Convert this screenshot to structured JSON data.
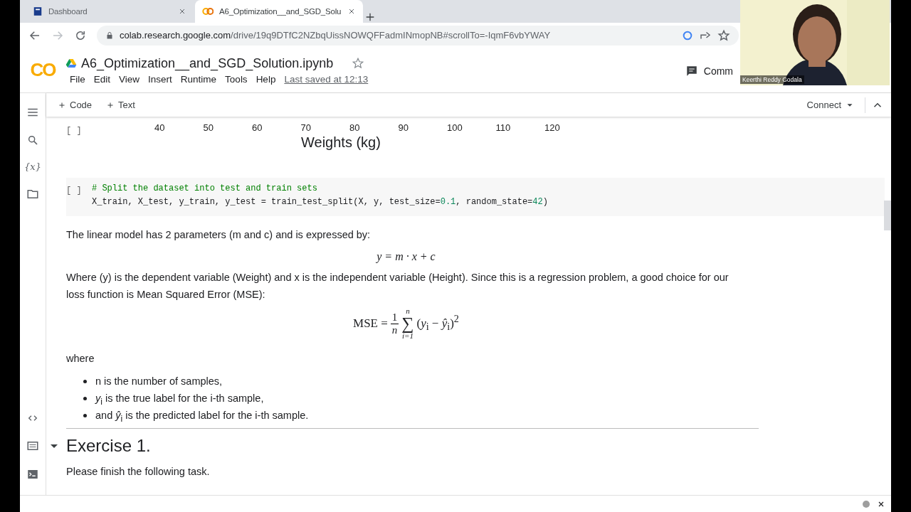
{
  "browser": {
    "tabs": [
      {
        "title": "Dashboard",
        "selected": false,
        "kind": "um"
      },
      {
        "title": "A6_Optimization__and_SGD_Solu",
        "selected": true,
        "kind": "colab"
      }
    ],
    "url_host": "colab.research.google.com",
    "url_path": "/drive/19q9DTfC2NZbqUissNOWQFFadmINmopNB#scrollTo=-IqmF6vbYWAY"
  },
  "notebook": {
    "logo": "CO",
    "title": "A6_Optimization__and_SGD_Solution.ipynb",
    "menu": [
      "File",
      "Edit",
      "View",
      "Insert",
      "Runtime",
      "Tools",
      "Help"
    ],
    "last_saved": "Last saved at 12:13",
    "comment": "Comm",
    "toolbar": [
      "Code",
      "Text"
    ],
    "connect": "Connect",
    "variables_icon": "{x}"
  },
  "cells": [
    {
      "kind": "output",
      "bracket": "[ ]",
      "x_tick_labels": [
        "40",
        "50",
        "60",
        "70",
        "80",
        "90",
        "100",
        "110",
        "120"
      ],
      "xlabel": "Weights (kg)"
    },
    {
      "kind": "code",
      "bracket": "[ ]",
      "lines": [
        [
          {
            "kind": "comment",
            "text": "# Split the dataset into test and train sets"
          }
        ],
        [
          {
            "kind": "plain",
            "text": "X_train, X_test, y_train, y_test = train_test_split(X, y, test_size="
          },
          {
            "kind": "number",
            "text": "0.1"
          },
          {
            "kind": "plain",
            "text": ", random_state="
          },
          {
            "kind": "number",
            "text": "42"
          },
          {
            "kind": "plain",
            "text": ")"
          }
        ]
      ]
    },
    {
      "kind": "text",
      "intro": "The linear model has 2 parameters (m and c) and is expressed by:",
      "formula1": "y = m · x + c",
      "para": "Where (y) is the dependent variable (Weight) and x is the independent variable (Height). Since this is a regression problem, a good choice for our loss function is Mean Squared Error (MSE):",
      "mse": {
        "lhs": "MSE =",
        "numerator": "1",
        "denominator": "n",
        "sum": "∑",
        "upper": "n",
        "lower": "i=1",
        "term": "(*y*$_{i}$ − *ŷ*$_{i}$)$^{2}$"
      },
      "where": "where",
      "bullets": [
        "n is the number of samples,",
        "*y*$_{i}$ is the true label for the i-th sample,",
        "and *ŷ*$_{i}$ is the predicted label for the i-th sample."
      ]
    },
    {
      "kind": "heading",
      "title": "Exercise 1.",
      "expanded": true,
      "text": "Please finish the following task."
    }
  ],
  "webcam": {
    "name": "Keerthi Reddy Godala"
  }
}
